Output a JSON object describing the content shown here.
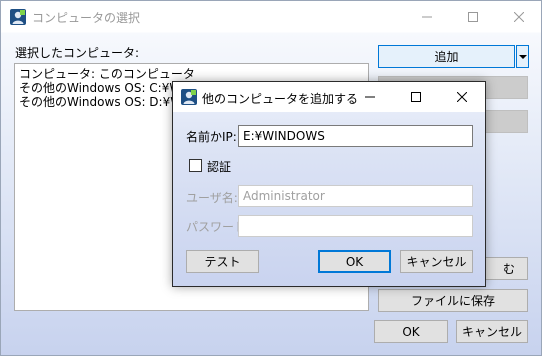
{
  "main": {
    "title": "コンピュータの選択",
    "selected_label": "選択したコンピュータ:",
    "list": [
      "コンピュータ: このコンピュータ",
      "その他のWindows OS: C:¥WIN",
      "その他のWindows OS: D:¥WIN"
    ],
    "add_label": "追加",
    "load_label": "む",
    "save_label": "ファイルに保存",
    "ok_label": "OK",
    "cancel_label": "キャンセル"
  },
  "dialog": {
    "title": "他のコンピュータを追加する",
    "name_label": "名前かIP:",
    "name_value": "E:¥WINDOWS",
    "auth_label": "認証",
    "auth_checked": false,
    "user_label": "ユーザ名:",
    "user_placeholder": "Administrator",
    "password_label": "パスワード:",
    "password_value": "",
    "test_label": "テスト",
    "ok_label": "OK",
    "cancel_label": "キャンセル"
  },
  "icons": {
    "app": "app-user-icon",
    "minimize": "minimize-icon",
    "maximize": "maximize-icon",
    "close": "close-icon",
    "dropdown": "chevron-down-icon"
  },
  "colors": {
    "accent": "#0078d7",
    "window_gradient_bottom": "#c7d2ee"
  }
}
